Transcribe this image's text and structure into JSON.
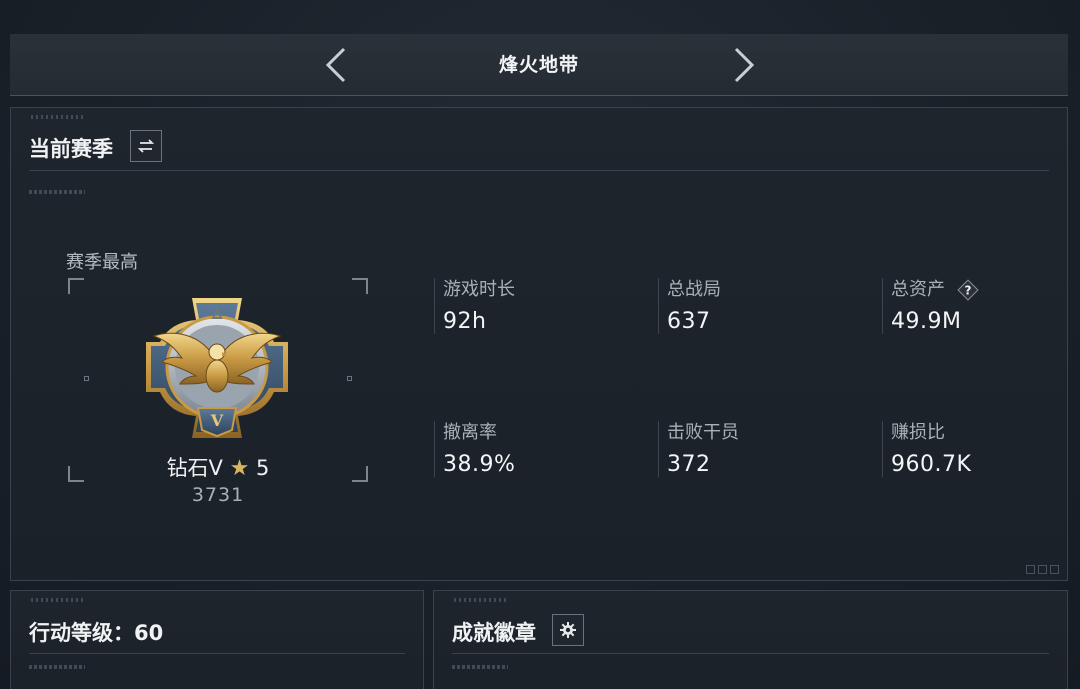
{
  "header": {
    "title": "烽火地带",
    "prev_icon": "chevron-left-icon",
    "next_icon": "chevron-right-icon"
  },
  "season": {
    "title": "当前赛季",
    "switch_icon": "swap-icon",
    "best_label": "赛季最高",
    "rank": {
      "name": "钻石V",
      "star_icon": "star-icon",
      "stars": "5",
      "score": "3731",
      "emblem_letter": "V",
      "emblem_icon": "eagle-emblem-icon"
    },
    "stats": [
      {
        "label": "游戏时长",
        "value": "92h"
      },
      {
        "label": "总战局",
        "value": "637"
      },
      {
        "label": "总资产",
        "value": "49.9M",
        "help": "?"
      },
      {
        "label": "撤离率",
        "value": "38.9%"
      },
      {
        "label": "击败干员",
        "value": "372"
      },
      {
        "label": "赚损比",
        "value": "960.7K"
      }
    ]
  },
  "level": {
    "title": "行动等级：60"
  },
  "badges": {
    "title": "成就徽章",
    "settings_icon": "gear-icon"
  },
  "colors": {
    "background": "#1a2028",
    "panel": "#1e252d",
    "border": "#3a424b",
    "gold": "#d8b560",
    "text_primary": "#f0f2f4",
    "text_secondary": "#a9b0b7"
  }
}
